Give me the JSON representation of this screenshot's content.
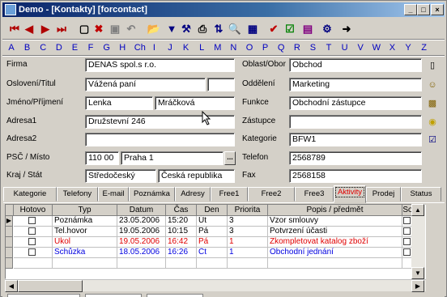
{
  "window": {
    "title": "Demo - [Kontakty] [forcontact]",
    "controls": {
      "minimize": "_",
      "maximize": "□",
      "close": "×"
    }
  },
  "toolbar": {
    "items": [
      {
        "name": "first-record-icon",
        "glyph": "⏮",
        "color": "#b00000"
      },
      {
        "name": "prev-record-icon",
        "glyph": "◀",
        "color": "#b00000"
      },
      {
        "name": "next-record-icon",
        "glyph": "▶",
        "color": "#b00000"
      },
      {
        "name": "last-record-icon",
        "glyph": "⏭",
        "color": "#b00000"
      },
      {
        "name": "new-record-icon",
        "glyph": "▢",
        "color": "#000000"
      },
      {
        "name": "delete-record-icon",
        "glyph": "✖",
        "color": "#c00000"
      },
      {
        "name": "save-icon",
        "glyph": "▣",
        "color": "#808080"
      },
      {
        "name": "undo-icon",
        "glyph": "↶",
        "color": "#808080"
      },
      {
        "name": "open-folder-icon",
        "glyph": "📂",
        "color": "#c08000"
      },
      {
        "name": "filter-icon",
        "glyph": "▼",
        "color": "#000080"
      },
      {
        "name": "filter-settings-icon",
        "glyph": "⚒",
        "color": "#000080"
      },
      {
        "name": "print-icon",
        "glyph": "⎙",
        "color": "#000000"
      },
      {
        "name": "sort-icon",
        "glyph": "⇅",
        "color": "#000080"
      },
      {
        "name": "search-icon",
        "glyph": "🔍",
        "color": "#000000"
      },
      {
        "name": "grid-view-icon",
        "glyph": "▦",
        "color": "#000080"
      },
      {
        "name": "check-icon",
        "glyph": "✔",
        "color": "#c00000"
      },
      {
        "name": "checkbox-icon",
        "glyph": "☑",
        "color": "#008000"
      },
      {
        "name": "report-icon",
        "glyph": "▤",
        "color": "#800080"
      },
      {
        "name": "tools-icon",
        "glyph": "⚙",
        "color": "#000080"
      },
      {
        "name": "exit-icon",
        "glyph": "➜",
        "color": "#000000"
      }
    ]
  },
  "alphabet": [
    "A",
    "B",
    "C",
    "D",
    "E",
    "F",
    "G",
    "H",
    "Ch",
    "I",
    "J",
    "K",
    "L",
    "M",
    "N",
    "O",
    "P",
    "Q",
    "R",
    "S",
    "T",
    "U",
    "V",
    "W",
    "X",
    "Y",
    "Z"
  ],
  "form": {
    "firma_label": "Firma",
    "firma_value": "DENAS spol.s r.o.",
    "osloveni_label": "Oslovení/Titul",
    "osloveni_value": "Vážená paní",
    "titul_value": "",
    "jmeno_label": "Jméno/Příjmení",
    "jmeno_value": "Lenka",
    "prijmeni_value": "Mráčková",
    "adresa1_label": "Adresa1",
    "adresa1_value": "Družstevní 246",
    "adresa2_label": "Adresa2",
    "adresa2_value": "",
    "psc_label": "PSČ / Místo",
    "psc_value": "110 00",
    "misto_value": "Praha 1",
    "misto_button": "...",
    "kraj_label": "Kraj / Stát",
    "kraj_value": "Středočeský",
    "stat_value": "Česká republika",
    "oblast_label": "Oblast/Obor",
    "oblast_value": "Obchod",
    "oddeleni_label": "Oddělení",
    "oddeleni_value": "Marketing",
    "funkce_label": "Funkce",
    "funkce_value": "Obchodní zástupce",
    "zastupce_label": "Zástupce",
    "zastupce_value": "",
    "kategorie_label": "Kategorie",
    "kategorie_value": "BFW1",
    "telefon_label": "Telefon",
    "telefon_value": "2568789",
    "fax_label": "Fax",
    "fax_value": "2568158"
  },
  "tabs": [
    {
      "name": "tab-kategorie",
      "label": "Kategorie"
    },
    {
      "name": "tab-telefony",
      "label": "Telefony"
    },
    {
      "name": "tab-email",
      "label": "E-mail"
    },
    {
      "name": "tab-poznamka",
      "label": "Poznámka"
    },
    {
      "name": "tab-adresy",
      "label": "Adresy"
    },
    {
      "name": "tab-free1",
      "label": "Free1"
    },
    {
      "name": "tab-free2",
      "label": "Free2"
    },
    {
      "name": "tab-free3",
      "label": "Free3"
    },
    {
      "name": "tab-aktivity",
      "label": "Aktivity",
      "active": true
    },
    {
      "name": "tab-prodej",
      "label": "Prodej"
    },
    {
      "name": "tab-status",
      "label": "Status"
    }
  ],
  "grid": {
    "columns": [
      "Hotovo",
      "Typ",
      "Datum",
      "Čas",
      "Den",
      "Priorita",
      "Popis / předmět",
      "So"
    ],
    "rows": [
      {
        "done": false,
        "typ": "Poznámka",
        "datum": "23.05.2006",
        "cas": "15:20",
        "den": "Út",
        "priorita": "3",
        "popis": "Vzor smlouvy",
        "color": "#000000",
        "current": true
      },
      {
        "done": false,
        "typ": "Tel.hovor",
        "datum": "19.05.2006",
        "cas": "10:15",
        "den": "Pá",
        "priorita": "3",
        "popis": "Potvrzení účasti",
        "color": "#000000"
      },
      {
        "done": false,
        "typ": "Úkol",
        "datum": "19.05.2006",
        "cas": "16:42",
        "den": "Pá",
        "priorita": "1",
        "popis": "Zkompletovat katalog zboží",
        "color": "#e00000"
      },
      {
        "done": false,
        "typ": "Schůzka",
        "datum": "18.05.2006",
        "cas": "16:26",
        "den": "Čt",
        "priorita": "1",
        "popis": "Obchodní jednání",
        "color": "#0000e0"
      }
    ]
  }
}
